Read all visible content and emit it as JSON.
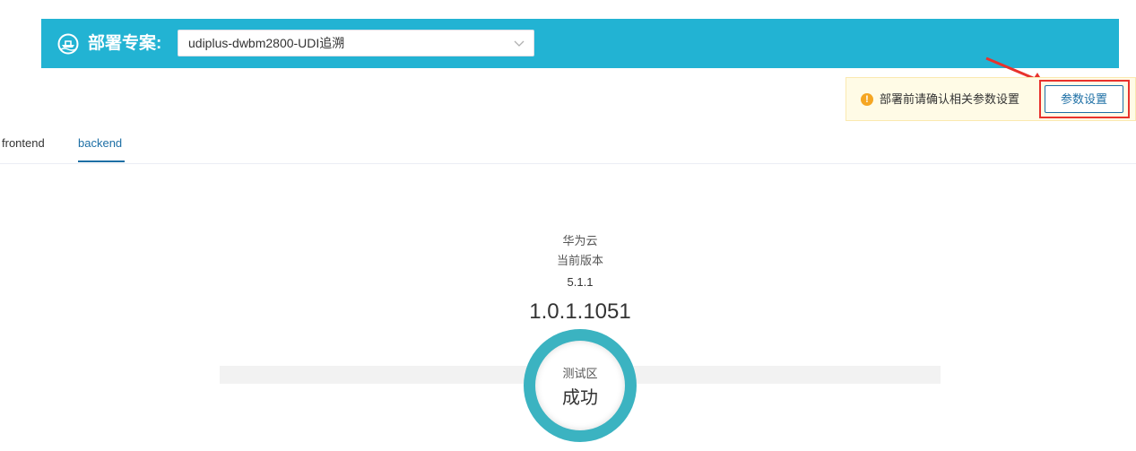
{
  "header": {
    "label": "部署专案:",
    "icon": "ship-icon",
    "project_select": {
      "value": "udiplus-dwbm2800-UDI追溯"
    }
  },
  "notice": {
    "text": "部署前请确认相关参数设置",
    "icon": "warning-icon",
    "button_label": "参数设置"
  },
  "tabs": [
    {
      "label": "frontend",
      "active": false
    },
    {
      "label": "backend",
      "active": true
    }
  ],
  "deployment": {
    "provider": "华为云",
    "current_version_label": "当前版本",
    "version_short": "5.1.1",
    "version_full": "1.0.1.1051",
    "stage": {
      "name": "测试区",
      "status": "成功"
    }
  },
  "colors": {
    "banner": "#22b3d3",
    "accent": "#1d6fa5",
    "stage_ring": "#3bb3c1",
    "warning": "#f5a623",
    "annotation_red": "#e8322c"
  }
}
